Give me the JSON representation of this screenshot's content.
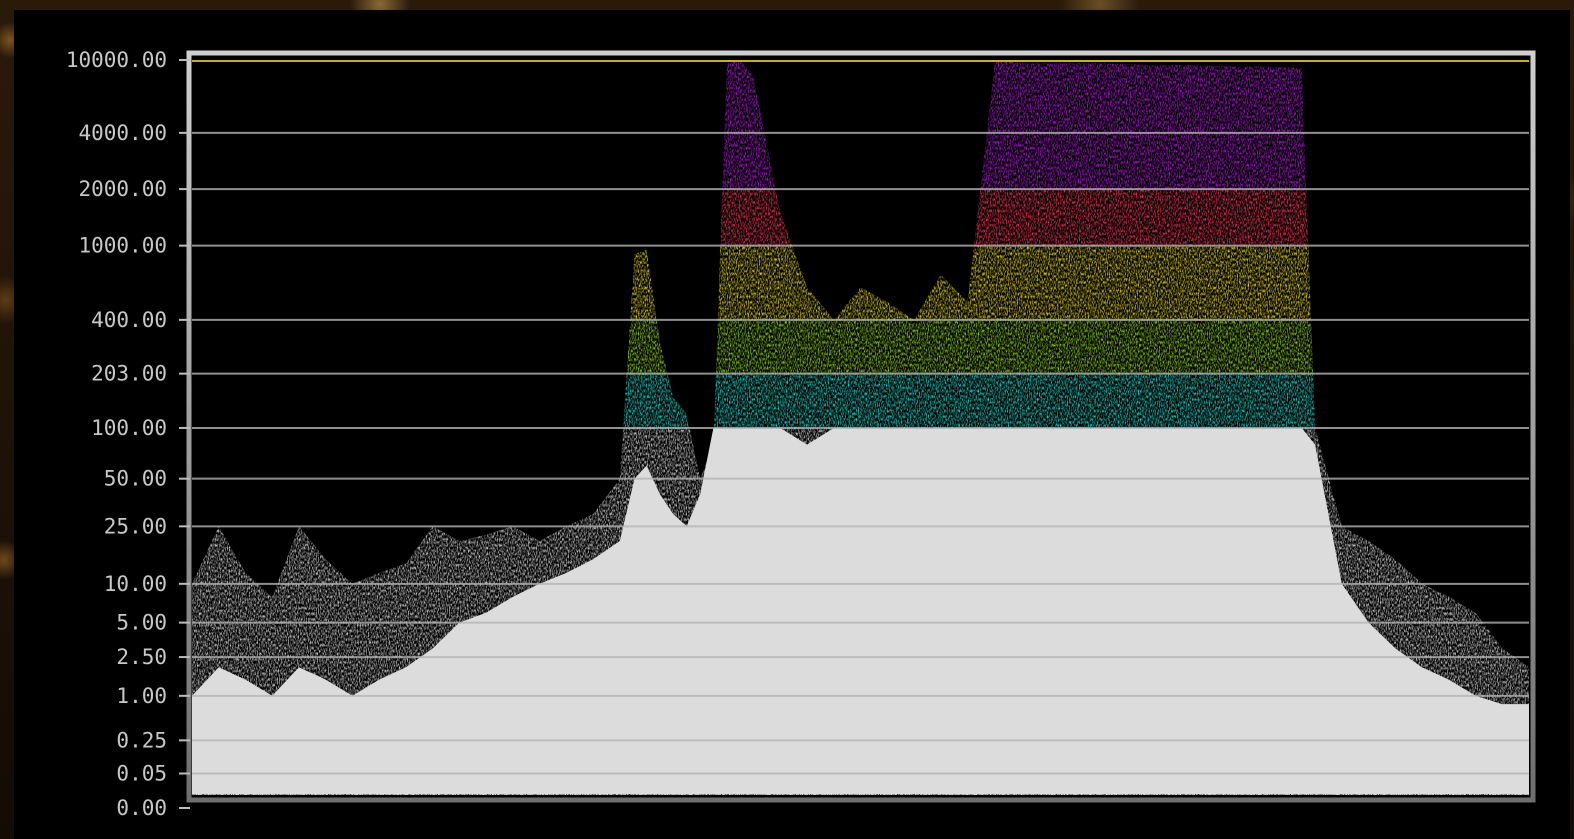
{
  "chart_data": {
    "type": "scatter",
    "title": "",
    "xlabel": "",
    "ylabel": "",
    "y_scale": "nonlinear (PQ-like)",
    "ylim": [
      0,
      10000
    ],
    "y_ticks": [
      {
        "value": 10000,
        "label": "10000.00"
      },
      {
        "value": 4000,
        "label": "4000.00"
      },
      {
        "value": 2000,
        "label": "2000.00"
      },
      {
        "value": 1000,
        "label": "1000.00"
      },
      {
        "value": 400,
        "label": "400.00"
      },
      {
        "value": 203,
        "label": "203.00"
      },
      {
        "value": 100,
        "label": "100.00"
      },
      {
        "value": 50,
        "label": "50.00"
      },
      {
        "value": 25,
        "label": "25.00"
      },
      {
        "value": 10,
        "label": "10.00"
      },
      {
        "value": 5,
        "label": "5.00"
      },
      {
        "value": 2.5,
        "label": "2.50"
      },
      {
        "value": 1,
        "label": "1.00"
      },
      {
        "value": 0.25,
        "label": "0.25"
      },
      {
        "value": 0.05,
        "label": "0.05"
      },
      {
        "value": 0,
        "label": "0.00"
      }
    ],
    "grid": true,
    "reference_line": {
      "value": 10000,
      "color": "#c9b200"
    },
    "x_range": [
      0,
      1
    ],
    "color_bands": [
      {
        "from": 0,
        "to": 100,
        "color": "#d9d9d9"
      },
      {
        "from": 100,
        "to": 203,
        "color": "#1ee6d8"
      },
      {
        "from": 203,
        "to": 400,
        "color": "#9be21a"
      },
      {
        "from": 400,
        "to": 1000,
        "color": "#f2e01a"
      },
      {
        "from": 1000,
        "to": 2000,
        "color": "#ff3a5a"
      },
      {
        "from": 2000,
        "to": 10000,
        "color": "#b51ee0"
      }
    ],
    "envelope": {
      "x": [
        0,
        0.02,
        0.04,
        0.06,
        0.08,
        0.1,
        0.12,
        0.14,
        0.16,
        0.18,
        0.2,
        0.22,
        0.24,
        0.26,
        0.28,
        0.3,
        0.32,
        0.331,
        0.34,
        0.35,
        0.36,
        0.37,
        0.38,
        0.39,
        0.4,
        0.41,
        0.42,
        0.44,
        0.46,
        0.48,
        0.5,
        0.52,
        0.54,
        0.56,
        0.58,
        0.6,
        0.6,
        0.61,
        0.62,
        0.64,
        0.66,
        0.68,
        0.7,
        0.72,
        0.74,
        0.76,
        0.78,
        0.8,
        0.82,
        0.83,
        0.84,
        0.86,
        0.88,
        0.9,
        0.92,
        0.94,
        0.96,
        0.98,
        1.0
      ],
      "max_nits": [
        10,
        25,
        12,
        8,
        25,
        15,
        10,
        12,
        14,
        25,
        20,
        22,
        25,
        20,
        25,
        30,
        50,
        900,
        950,
        300,
        150,
        120,
        50,
        80,
        9500,
        10000,
        8000,
        1500,
        600,
        400,
        600,
        500,
        400,
        700,
        500,
        9000,
        10000,
        9800,
        9600,
        9600,
        9600,
        9600,
        9500,
        9300,
        9400,
        9300,
        9200,
        9200,
        9100,
        9000,
        100,
        25,
        20,
        15,
        10,
        8,
        6,
        3,
        2
      ],
      "bright_floor_nits": [
        1,
        2,
        1.5,
        1,
        2,
        1.5,
        1,
        1.5,
        2,
        3,
        5,
        6,
        8,
        10,
        12,
        15,
        20,
        50,
        60,
        40,
        30,
        25,
        40,
        100,
        100,
        100,
        100,
        100,
        80,
        100,
        100,
        100,
        100,
        100,
        100,
        100,
        100,
        100,
        100,
        100,
        100,
        100,
        100,
        100,
        100,
        100,
        100,
        100,
        100,
        100,
        80,
        10,
        5,
        3,
        2,
        1.5,
        1,
        0.8,
        0.8
      ]
    }
  }
}
